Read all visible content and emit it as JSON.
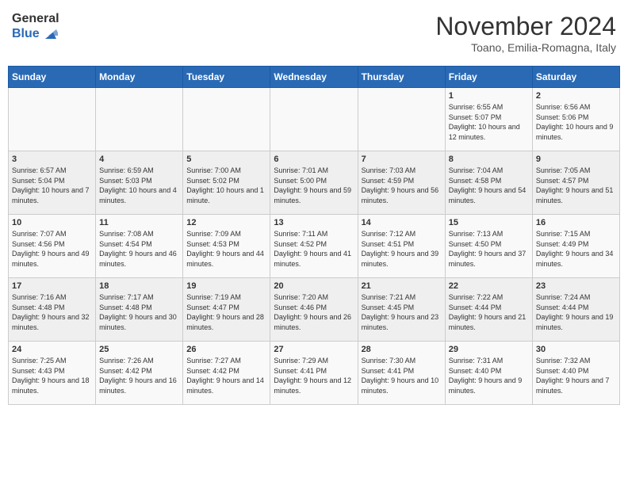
{
  "header": {
    "logo_line1": "General",
    "logo_line2": "Blue",
    "month_title": "November 2024",
    "location": "Toano, Emilia-Romagna, Italy"
  },
  "weekdays": [
    "Sunday",
    "Monday",
    "Tuesday",
    "Wednesday",
    "Thursday",
    "Friday",
    "Saturday"
  ],
  "weeks": [
    [
      {
        "day": "",
        "info": ""
      },
      {
        "day": "",
        "info": ""
      },
      {
        "day": "",
        "info": ""
      },
      {
        "day": "",
        "info": ""
      },
      {
        "day": "",
        "info": ""
      },
      {
        "day": "1",
        "info": "Sunrise: 6:55 AM\nSunset: 5:07 PM\nDaylight: 10 hours and 12 minutes."
      },
      {
        "day": "2",
        "info": "Sunrise: 6:56 AM\nSunset: 5:06 PM\nDaylight: 10 hours and 9 minutes."
      }
    ],
    [
      {
        "day": "3",
        "info": "Sunrise: 6:57 AM\nSunset: 5:04 PM\nDaylight: 10 hours and 7 minutes."
      },
      {
        "day": "4",
        "info": "Sunrise: 6:59 AM\nSunset: 5:03 PM\nDaylight: 10 hours and 4 minutes."
      },
      {
        "day": "5",
        "info": "Sunrise: 7:00 AM\nSunset: 5:02 PM\nDaylight: 10 hours and 1 minute."
      },
      {
        "day": "6",
        "info": "Sunrise: 7:01 AM\nSunset: 5:00 PM\nDaylight: 9 hours and 59 minutes."
      },
      {
        "day": "7",
        "info": "Sunrise: 7:03 AM\nSunset: 4:59 PM\nDaylight: 9 hours and 56 minutes."
      },
      {
        "day": "8",
        "info": "Sunrise: 7:04 AM\nSunset: 4:58 PM\nDaylight: 9 hours and 54 minutes."
      },
      {
        "day": "9",
        "info": "Sunrise: 7:05 AM\nSunset: 4:57 PM\nDaylight: 9 hours and 51 minutes."
      }
    ],
    [
      {
        "day": "10",
        "info": "Sunrise: 7:07 AM\nSunset: 4:56 PM\nDaylight: 9 hours and 49 minutes."
      },
      {
        "day": "11",
        "info": "Sunrise: 7:08 AM\nSunset: 4:54 PM\nDaylight: 9 hours and 46 minutes."
      },
      {
        "day": "12",
        "info": "Sunrise: 7:09 AM\nSunset: 4:53 PM\nDaylight: 9 hours and 44 minutes."
      },
      {
        "day": "13",
        "info": "Sunrise: 7:11 AM\nSunset: 4:52 PM\nDaylight: 9 hours and 41 minutes."
      },
      {
        "day": "14",
        "info": "Sunrise: 7:12 AM\nSunset: 4:51 PM\nDaylight: 9 hours and 39 minutes."
      },
      {
        "day": "15",
        "info": "Sunrise: 7:13 AM\nSunset: 4:50 PM\nDaylight: 9 hours and 37 minutes."
      },
      {
        "day": "16",
        "info": "Sunrise: 7:15 AM\nSunset: 4:49 PM\nDaylight: 9 hours and 34 minutes."
      }
    ],
    [
      {
        "day": "17",
        "info": "Sunrise: 7:16 AM\nSunset: 4:48 PM\nDaylight: 9 hours and 32 minutes."
      },
      {
        "day": "18",
        "info": "Sunrise: 7:17 AM\nSunset: 4:48 PM\nDaylight: 9 hours and 30 minutes."
      },
      {
        "day": "19",
        "info": "Sunrise: 7:19 AM\nSunset: 4:47 PM\nDaylight: 9 hours and 28 minutes."
      },
      {
        "day": "20",
        "info": "Sunrise: 7:20 AM\nSunset: 4:46 PM\nDaylight: 9 hours and 26 minutes."
      },
      {
        "day": "21",
        "info": "Sunrise: 7:21 AM\nSunset: 4:45 PM\nDaylight: 9 hours and 23 minutes."
      },
      {
        "day": "22",
        "info": "Sunrise: 7:22 AM\nSunset: 4:44 PM\nDaylight: 9 hours and 21 minutes."
      },
      {
        "day": "23",
        "info": "Sunrise: 7:24 AM\nSunset: 4:44 PM\nDaylight: 9 hours and 19 minutes."
      }
    ],
    [
      {
        "day": "24",
        "info": "Sunrise: 7:25 AM\nSunset: 4:43 PM\nDaylight: 9 hours and 18 minutes."
      },
      {
        "day": "25",
        "info": "Sunrise: 7:26 AM\nSunset: 4:42 PM\nDaylight: 9 hours and 16 minutes."
      },
      {
        "day": "26",
        "info": "Sunrise: 7:27 AM\nSunset: 4:42 PM\nDaylight: 9 hours and 14 minutes."
      },
      {
        "day": "27",
        "info": "Sunrise: 7:29 AM\nSunset: 4:41 PM\nDaylight: 9 hours and 12 minutes."
      },
      {
        "day": "28",
        "info": "Sunrise: 7:30 AM\nSunset: 4:41 PM\nDaylight: 9 hours and 10 minutes."
      },
      {
        "day": "29",
        "info": "Sunrise: 7:31 AM\nSunset: 4:40 PM\nDaylight: 9 hours and 9 minutes."
      },
      {
        "day": "30",
        "info": "Sunrise: 7:32 AM\nSunset: 4:40 PM\nDaylight: 9 hours and 7 minutes."
      }
    ]
  ]
}
